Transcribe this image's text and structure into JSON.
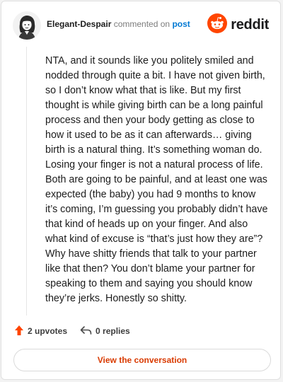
{
  "comment": {
    "username": "Elegant-Despair",
    "commented_on": "commented on",
    "post_link": "post",
    "body": "NTA, and it sounds like you politely smiled and nodded through quite a bit. I have not given birth, so I don’t know what that is like. But my first thought is while giving birth can be a long painful process and then your body getting as close to how it used to be as it can afterwards… giving birth is a natural thing. It’s something woman do. Losing your finger is not a natural process of life. Both are going to be painful, and at least one was expected (the baby) you had 9 months to know it’s coming, I’m guessing you probably didn’t have that kind of heads up on your finger. And also what kind of excuse is “that’s just how they are”? Why have shitty friends that talk to your partner like that then? You don’t blame your partner for speaking to them and saying you should know they’re jerks. Honestly so shitty."
  },
  "brand": {
    "name": "reddit",
    "icon": "reddit-snoo-icon",
    "color": "#ff4500"
  },
  "actions": {
    "upvotes_label": "2 upvotes",
    "upvote_icon": "upvote-arrow-icon",
    "upvote_color": "#ff4500",
    "replies_label": "0 replies",
    "reply_icon": "reply-arrow-icon"
  },
  "cta": {
    "label": "View the conversation",
    "color": "#d93a00"
  },
  "avatar": {
    "icon": "user-avatar-icon"
  }
}
